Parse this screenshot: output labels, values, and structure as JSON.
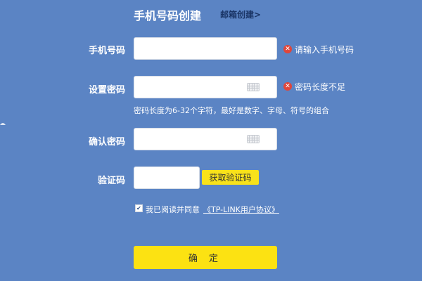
{
  "header": {
    "title": "手机号码创建",
    "alt_link": "邮箱创建>"
  },
  "form": {
    "phone": {
      "label": "手机号码",
      "value": "",
      "error": "请输入手机号码"
    },
    "password": {
      "label": "设置密码",
      "value": "",
      "error": "密码长度不足",
      "hint": "密码长度为6-32个字符，最好是数字、字母、符号的组合"
    },
    "confirm": {
      "label": "确认密码",
      "value": ""
    },
    "captcha": {
      "label": "验证码",
      "value": "",
      "button": "获取验证码"
    },
    "agreement": {
      "text": "我已阅读并同意",
      "link": "《TP-LINK用户协议》",
      "checked": true
    },
    "submit": "确 定"
  },
  "icons": {
    "keyboard": "keyboard-icon",
    "error": "error-icon",
    "check": "checkmark-icon"
  },
  "colors": {
    "background": "#5b84c4",
    "accent_yellow": "#fce212",
    "error_red": "#e0463a",
    "link_dark": "#1a3566"
  }
}
